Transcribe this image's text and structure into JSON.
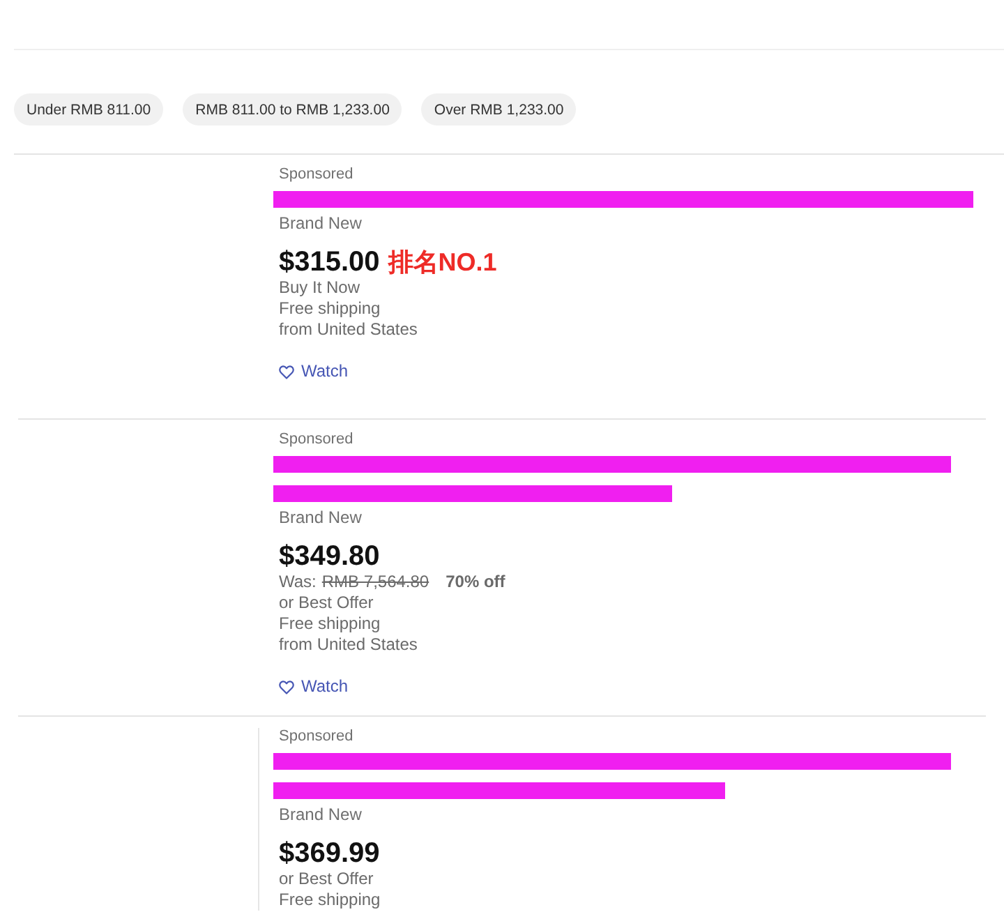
{
  "filters": [
    "Under RMB 811.00",
    "RMB 811.00 to RMB 1,233.00",
    "Over RMB 1,233.00"
  ],
  "listings": [
    {
      "sponsored": "Sponsored",
      "title_redactions": [
        {
          "kind": "full"
        }
      ],
      "condition": "Brand New",
      "price": "$315.00",
      "annotation": "排名NO.1",
      "details": [
        {
          "kind": "format",
          "text": "Buy It Now"
        },
        {
          "kind": "shipping",
          "text": "Free shipping"
        },
        {
          "kind": "location",
          "text": "from United States"
        }
      ],
      "watch": "Watch"
    },
    {
      "sponsored": "Sponsored",
      "title_redactions": [
        {
          "kind": "long"
        },
        {
          "kind": "short"
        }
      ],
      "condition": "Brand New",
      "price": "$349.80",
      "details": [
        {
          "kind": "was",
          "label": "Was:",
          "original_price": "RMB 7,564.80",
          "discount": "70% off"
        },
        {
          "kind": "format",
          "text": "or Best Offer"
        },
        {
          "kind": "shipping",
          "text": "Free shipping"
        },
        {
          "kind": "location",
          "text": "from United States"
        }
      ],
      "watch": "Watch"
    },
    {
      "sponsored": "Sponsored",
      "title_redactions": [
        {
          "kind": "long"
        },
        {
          "kind": "medium"
        }
      ],
      "condition": "Brand New",
      "price": "$369.99",
      "details": [
        {
          "kind": "format",
          "text": "or Best Offer"
        },
        {
          "kind": "shipping",
          "text": "Free shipping"
        }
      ]
    }
  ]
}
